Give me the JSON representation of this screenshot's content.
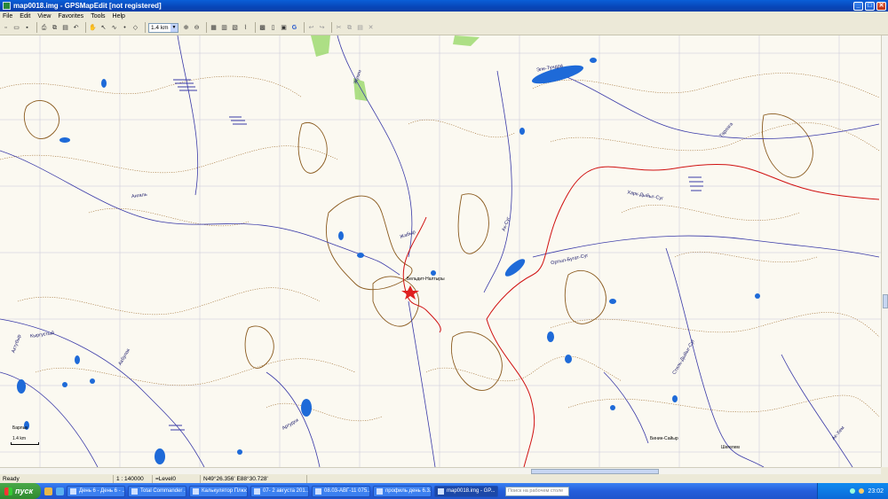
{
  "window": {
    "title": "map0018.img - GPSMapEdit [not registered]",
    "minimize": "_",
    "maximize": "□",
    "close": "✕"
  },
  "menu": [
    "File",
    "Edit",
    "View",
    "Favorites",
    "Tools",
    "Help"
  ],
  "toolbar": {
    "scale_value": "1.4 km",
    "icons": [
      "new-icon",
      "open-icon",
      "save-icon",
      "print-icon",
      "copy-icon",
      "paste-icon",
      "undo-icon",
      "hand-icon",
      "select-icon",
      "zoom-in-icon",
      "zoom-out-icon",
      "grid-icon",
      "layers-icon",
      "google-icon",
      "cut-icon",
      "delete-icon"
    ]
  },
  "map": {
    "labels": [
      "Жукин",
      "Ангаль",
      "Жабыр",
      "Бельдит-Налтыры",
      "Актубыр",
      "Кыргустый",
      "Акбулак",
      "Аргудхи",
      "Харк-Дыйыг-Суг",
      "Стиль-Дыйыг-Суг",
      "Ортыл-Бугат-Суг",
      "Барлык",
      "Ак-Суг",
      "Тарлага",
      "Эле-Тундра",
      "Бинин-Сайыр",
      "Шегелем",
      "Ак-Хем"
    ],
    "scale_bar_label": "1.4 km",
    "colors": {
      "background": "#fbf9f1",
      "contour": "#8a5a1e",
      "river": "#3a3aa8",
      "lake": "#1e6ad8",
      "track": "#d01010",
      "forest": "#9ad86a"
    }
  },
  "status": {
    "ready": "Ready",
    "scale": "1 : 140000",
    "level": "=Level0",
    "coords": "N49°26.356' E88°30.728'"
  },
  "taskbar": {
    "start": "пуск",
    "tasks": [
      "День 6 - День 6 - ...",
      "Total Commander ...",
      "Калькулятор Плюс",
      "07- 2 августа 201...",
      "08.03-АВГ-11 075...",
      "профиль день 6.3...",
      "map0018.img - GP..."
    ],
    "search_placeholder": "Поиск на рабочем столе",
    "clock": "23:02"
  }
}
